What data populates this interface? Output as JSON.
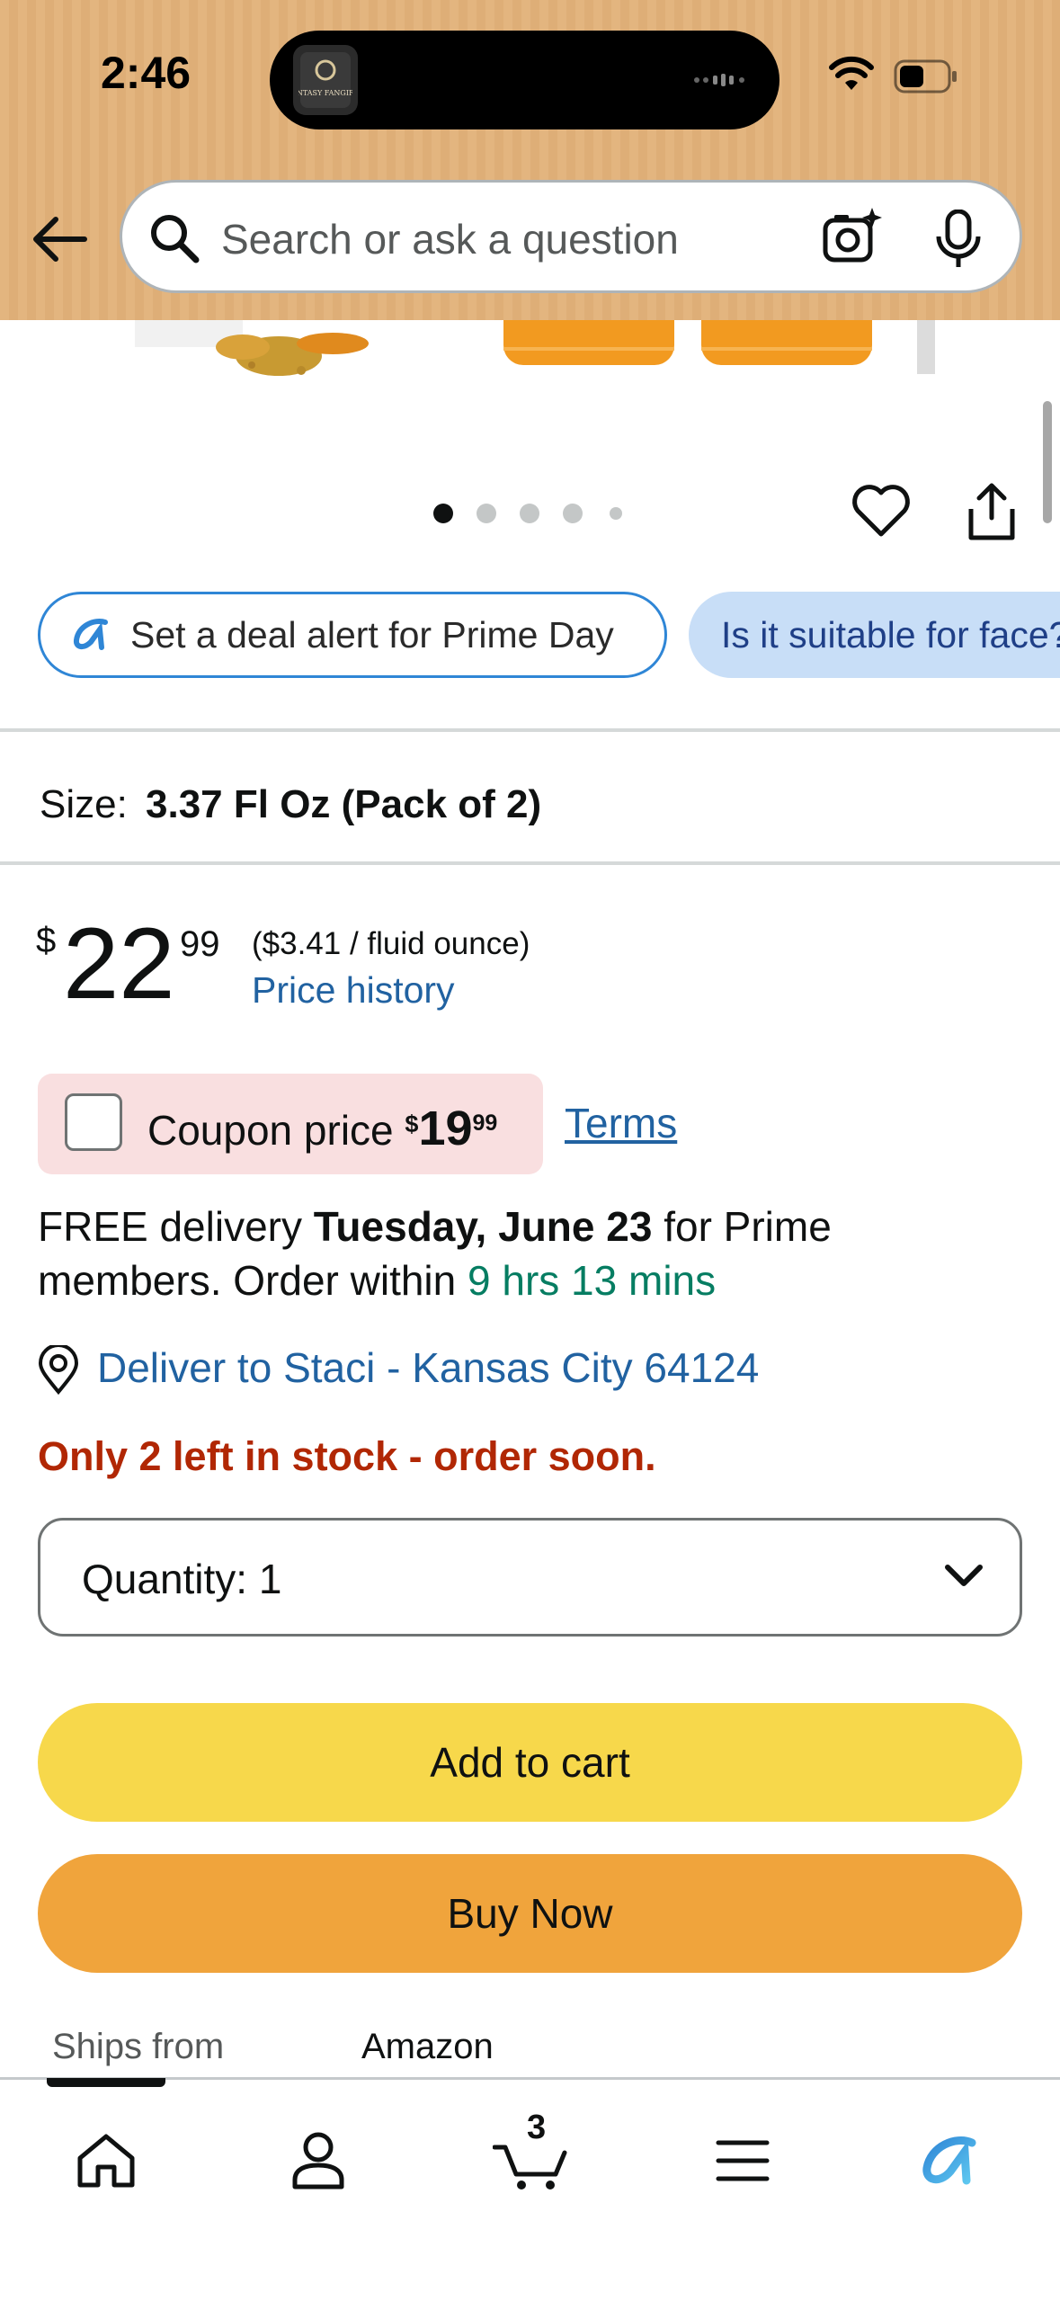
{
  "status_bar": {
    "time": "2:46",
    "island_app": "FANTASY FANGIRLS"
  },
  "search": {
    "placeholder": "Search or ask a question"
  },
  "carousel": {
    "total": 5,
    "active_index": 0
  },
  "chips": {
    "deal_alert": "Set a deal alert for Prime Day",
    "question": "Is it suitable for face?"
  },
  "size": {
    "label": "Size:",
    "value": "3.37 Fl Oz (Pack of 2)"
  },
  "price": {
    "symbol": "$",
    "whole": "22",
    "fraction": "99",
    "unit_price": "($3.41 / fluid ounce)",
    "history_link": "Price history"
  },
  "coupon": {
    "label": "Coupon price",
    "symbol": "$",
    "whole": "19",
    "fraction": "99",
    "terms": "Terms"
  },
  "delivery": {
    "prefix": "FREE delivery ",
    "date": "Tuesday, June 23",
    "middle": " for Prime members. Order within ",
    "countdown": "9 hrs 13 mins"
  },
  "deliver_to": "Deliver to Staci - Kansas City 64124",
  "stock": "Only 2 left in stock - order soon.",
  "quantity": {
    "label": "Quantity:",
    "value": "1"
  },
  "buttons": {
    "add_to_cart": "Add to cart",
    "buy_now": "Buy Now"
  },
  "ships_from": {
    "label": "Ships from",
    "value": "Amazon"
  },
  "bottom_nav": {
    "cart_count": "3",
    "items": [
      "home-icon",
      "account-icon",
      "cart-icon",
      "menu-icon",
      "rufus-icon"
    ]
  },
  "colors": {
    "header_bg": "#e3b57f",
    "link": "#2162a1",
    "stock_red": "#b12704",
    "green": "#067d62",
    "add_to_cart": "#f7d84b",
    "buy_now": "#f0a43c",
    "coupon_bg": "#f9dfe0"
  }
}
